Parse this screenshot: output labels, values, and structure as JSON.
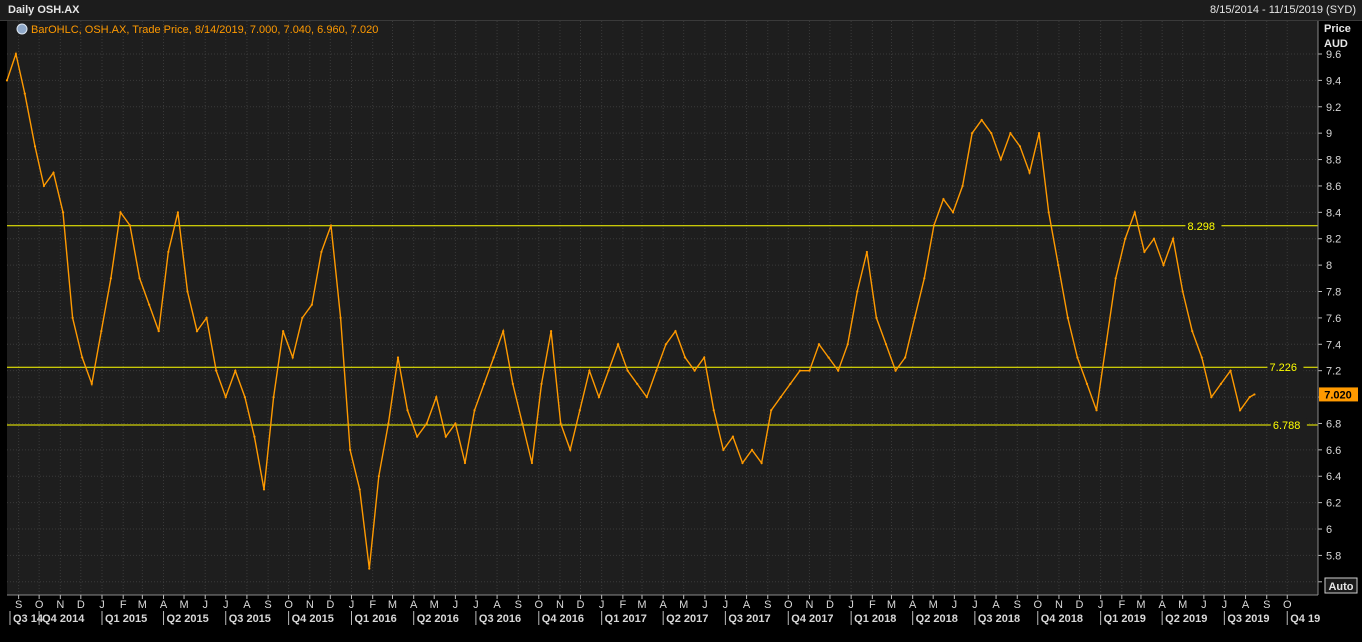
{
  "window": {
    "title": "Daily OSH.AX",
    "date_range": "8/15/2014 - 11/15/2019 (SYD)"
  },
  "legend": {
    "icon": "series-settings-icon",
    "text": "BarOHLC, OSH.AX, Trade Price, 8/14/2019, 7.000, 7.040, 6.960, 7.020"
  },
  "axis": {
    "price_label": "Price",
    "currency_label": "AUD",
    "auto_button": "Auto",
    "last_price_label": "7.020"
  },
  "colors": {
    "background": "#1e1e1e",
    "grid": "#3a3a3a",
    "series": "#ff9a00",
    "level_line": "#ffff00",
    "axis_text": "#d8d8d8"
  },
  "chart_data": {
    "type": "line",
    "series": [
      {
        "name": "OSH.AX",
        "x": [
          "2014-08-15",
          "2014-08-28",
          "2014-09-10",
          "2014-09-25",
          "2014-10-08",
          "2014-10-22",
          "2014-11-05",
          "2014-11-19",
          "2014-12-03",
          "2014-12-17",
          "2014-12-31",
          "2015-01-14",
          "2015-01-28",
          "2015-02-11",
          "2015-02-25",
          "2015-03-11",
          "2015-03-25",
          "2015-04-08",
          "2015-04-22",
          "2015-05-06",
          "2015-05-20",
          "2015-06-03",
          "2015-06-17",
          "2015-07-01",
          "2015-07-15",
          "2015-07-29",
          "2015-08-12",
          "2015-08-26",
          "2015-09-09",
          "2015-09-23",
          "2015-10-07",
          "2015-10-21",
          "2015-11-04",
          "2015-11-18",
          "2015-12-02",
          "2015-12-16",
          "2015-12-30",
          "2016-01-13",
          "2016-01-27",
          "2016-02-10",
          "2016-02-24",
          "2016-03-09",
          "2016-03-23",
          "2016-04-06",
          "2016-04-20",
          "2016-05-04",
          "2016-05-18",
          "2016-06-01",
          "2016-06-15",
          "2016-06-29",
          "2016-07-13",
          "2016-07-27",
          "2016-08-10",
          "2016-08-24",
          "2016-09-07",
          "2016-09-21",
          "2016-10-05",
          "2016-10-19",
          "2016-11-02",
          "2016-11-16",
          "2016-11-30",
          "2016-12-14",
          "2016-12-28",
          "2017-01-11",
          "2017-01-25",
          "2017-02-08",
          "2017-02-22",
          "2017-03-08",
          "2017-03-22",
          "2017-04-05",
          "2017-04-19",
          "2017-05-03",
          "2017-05-17",
          "2017-05-31",
          "2017-06-14",
          "2017-06-28",
          "2017-07-12",
          "2017-07-26",
          "2017-08-09",
          "2017-08-23",
          "2017-09-06",
          "2017-09-20",
          "2017-10-04",
          "2017-10-18",
          "2017-11-01",
          "2017-11-15",
          "2017-11-29",
          "2017-12-13",
          "2017-12-27",
          "2018-01-10",
          "2018-01-24",
          "2018-02-07",
          "2018-02-21",
          "2018-03-07",
          "2018-03-21",
          "2018-04-04",
          "2018-04-18",
          "2018-05-02",
          "2018-05-16",
          "2018-05-30",
          "2018-06-13",
          "2018-06-27",
          "2018-07-11",
          "2018-07-25",
          "2018-08-08",
          "2018-08-22",
          "2018-09-05",
          "2018-09-19",
          "2018-10-03",
          "2018-10-17",
          "2018-10-31",
          "2018-11-14",
          "2018-11-28",
          "2018-12-12",
          "2018-12-26",
          "2019-01-09",
          "2019-01-23",
          "2019-02-06",
          "2019-02-20",
          "2019-03-06",
          "2019-03-20",
          "2019-04-03",
          "2019-04-17",
          "2019-05-01",
          "2019-05-15",
          "2019-05-29",
          "2019-06-12",
          "2019-06-26",
          "2019-07-10",
          "2019-07-24",
          "2019-08-07",
          "2019-08-14"
        ],
        "values": [
          9.4,
          9.6,
          9.3,
          8.9,
          8.6,
          8.7,
          8.4,
          7.6,
          7.3,
          7.1,
          7.5,
          7.9,
          8.4,
          8.3,
          7.9,
          7.7,
          7.5,
          8.1,
          8.4,
          7.8,
          7.5,
          7.6,
          7.2,
          7.0,
          7.2,
          7.0,
          6.7,
          6.3,
          7.0,
          7.5,
          7.3,
          7.6,
          7.7,
          8.1,
          8.3,
          7.6,
          6.6,
          6.3,
          5.7,
          6.4,
          6.8,
          7.3,
          6.9,
          6.7,
          6.8,
          7.0,
          6.7,
          6.8,
          6.5,
          6.9,
          7.1,
          7.3,
          7.5,
          7.1,
          6.8,
          6.5,
          7.1,
          7.5,
          6.8,
          6.6,
          6.9,
          7.2,
          7.0,
          7.2,
          7.4,
          7.2,
          7.1,
          7.0,
          7.2,
          7.4,
          7.5,
          7.3,
          7.2,
          7.3,
          6.9,
          6.6,
          6.7,
          6.5,
          6.6,
          6.5,
          6.9,
          7.0,
          7.1,
          7.2,
          7.2,
          7.4,
          7.3,
          7.2,
          7.4,
          7.8,
          8.1,
          7.6,
          7.4,
          7.2,
          7.3,
          7.6,
          7.9,
          8.3,
          8.5,
          8.4,
          8.6,
          9.0,
          9.1,
          9.0,
          8.8,
          9.0,
          8.9,
          8.7,
          9.0,
          8.4,
          8.0,
          7.6,
          7.3,
          7.1,
          6.9,
          7.4,
          7.9,
          8.2,
          8.4,
          8.1,
          8.2,
          8.0,
          8.2,
          7.8,
          7.5,
          7.3,
          7.0,
          7.1,
          7.2,
          6.9,
          7.0,
          7.02
        ]
      }
    ],
    "y_axis": {
      "label": "Price AUD",
      "ylim": [
        5.5,
        9.85
      ],
      "ticks": [
        5.6,
        5.8,
        6,
        6.2,
        6.4,
        6.6,
        6.8,
        7,
        7.2,
        7.4,
        7.6,
        7.8,
        8,
        8.2,
        8.4,
        8.6,
        8.8,
        9,
        9.2,
        9.4,
        9.6
      ],
      "tick_labels": [
        "5.6",
        "5.8",
        "6",
        "6.2",
        "6.4",
        "6.6",
        "6.8",
        "7",
        "7.2",
        "7.4",
        "7.6",
        "7.8",
        "8",
        "8.2",
        "8.4",
        "8.6",
        "8.8",
        "9",
        "9.2",
        "9.4",
        "9.6"
      ],
      "position": "right"
    },
    "x_axis": {
      "range": [
        "2014-08-15",
        "2019-11-15"
      ],
      "months": [
        {
          "date": "2014-09-01",
          "label": "S"
        },
        {
          "date": "2014-10-01",
          "label": "O"
        },
        {
          "date": "2014-11-01",
          "label": "N"
        },
        {
          "date": "2014-12-01",
          "label": "D"
        },
        {
          "date": "2015-01-01",
          "label": "J"
        },
        {
          "date": "2015-02-01",
          "label": "F"
        },
        {
          "date": "2015-03-01",
          "label": "M"
        },
        {
          "date": "2015-04-01",
          "label": "A"
        },
        {
          "date": "2015-05-01",
          "label": "M"
        },
        {
          "date": "2015-06-01",
          "label": "J"
        },
        {
          "date": "2015-07-01",
          "label": "J"
        },
        {
          "date": "2015-08-01",
          "label": "A"
        },
        {
          "date": "2015-09-01",
          "label": "S"
        },
        {
          "date": "2015-10-01",
          "label": "O"
        },
        {
          "date": "2015-11-01",
          "label": "N"
        },
        {
          "date": "2015-12-01",
          "label": "D"
        },
        {
          "date": "2016-01-01",
          "label": "J"
        },
        {
          "date": "2016-02-01",
          "label": "F"
        },
        {
          "date": "2016-03-01",
          "label": "M"
        },
        {
          "date": "2016-04-01",
          "label": "A"
        },
        {
          "date": "2016-05-01",
          "label": "M"
        },
        {
          "date": "2016-06-01",
          "label": "J"
        },
        {
          "date": "2016-07-01",
          "label": "J"
        },
        {
          "date": "2016-08-01",
          "label": "A"
        },
        {
          "date": "2016-09-01",
          "label": "S"
        },
        {
          "date": "2016-10-01",
          "label": "O"
        },
        {
          "date": "2016-11-01",
          "label": "N"
        },
        {
          "date": "2016-12-01",
          "label": "D"
        },
        {
          "date": "2017-01-01",
          "label": "J"
        },
        {
          "date": "2017-02-01",
          "label": "F"
        },
        {
          "date": "2017-03-01",
          "label": "M"
        },
        {
          "date": "2017-04-01",
          "label": "A"
        },
        {
          "date": "2017-05-01",
          "label": "M"
        },
        {
          "date": "2017-06-01",
          "label": "J"
        },
        {
          "date": "2017-07-01",
          "label": "J"
        },
        {
          "date": "2017-08-01",
          "label": "A"
        },
        {
          "date": "2017-09-01",
          "label": "S"
        },
        {
          "date": "2017-10-01",
          "label": "O"
        },
        {
          "date": "2017-11-01",
          "label": "N"
        },
        {
          "date": "2017-12-01",
          "label": "D"
        },
        {
          "date": "2018-01-01",
          "label": "J"
        },
        {
          "date": "2018-02-01",
          "label": "F"
        },
        {
          "date": "2018-03-01",
          "label": "M"
        },
        {
          "date": "2018-04-01",
          "label": "A"
        },
        {
          "date": "2018-05-01",
          "label": "M"
        },
        {
          "date": "2018-06-01",
          "label": "J"
        },
        {
          "date": "2018-07-01",
          "label": "J"
        },
        {
          "date": "2018-08-01",
          "label": "A"
        },
        {
          "date": "2018-09-01",
          "label": "S"
        },
        {
          "date": "2018-10-01",
          "label": "O"
        },
        {
          "date": "2018-11-01",
          "label": "N"
        },
        {
          "date": "2018-12-01",
          "label": "D"
        },
        {
          "date": "2019-01-01",
          "label": "J"
        },
        {
          "date": "2019-02-01",
          "label": "F"
        },
        {
          "date": "2019-03-01",
          "label": "M"
        },
        {
          "date": "2019-04-01",
          "label": "A"
        },
        {
          "date": "2019-05-01",
          "label": "M"
        },
        {
          "date": "2019-06-01",
          "label": "J"
        },
        {
          "date": "2019-07-01",
          "label": "J"
        },
        {
          "date": "2019-08-01",
          "label": "A"
        },
        {
          "date": "2019-09-01",
          "label": "S"
        },
        {
          "date": "2019-10-01",
          "label": "O"
        }
      ],
      "quarters": [
        {
          "date": "2014-08-15",
          "label": "Q3 14"
        },
        {
          "date": "2014-10-01",
          "label": "Q4 2014"
        },
        {
          "date": "2015-01-01",
          "label": "Q1 2015"
        },
        {
          "date": "2015-04-01",
          "label": "Q2 2015"
        },
        {
          "date": "2015-07-01",
          "label": "Q3 2015"
        },
        {
          "date": "2015-10-01",
          "label": "Q4 2015"
        },
        {
          "date": "2016-01-01",
          "label": "Q1 2016"
        },
        {
          "date": "2016-04-01",
          "label": "Q2 2016"
        },
        {
          "date": "2016-07-01",
          "label": "Q3 2016"
        },
        {
          "date": "2016-10-01",
          "label": "Q4 2016"
        },
        {
          "date": "2017-01-01",
          "label": "Q1 2017"
        },
        {
          "date": "2017-04-01",
          "label": "Q2 2017"
        },
        {
          "date": "2017-07-01",
          "label": "Q3 2017"
        },
        {
          "date": "2017-10-01",
          "label": "Q4 2017"
        },
        {
          "date": "2018-01-01",
          "label": "Q1 2018"
        },
        {
          "date": "2018-04-01",
          "label": "Q2 2018"
        },
        {
          "date": "2018-07-01",
          "label": "Q3 2018"
        },
        {
          "date": "2018-10-01",
          "label": "Q4 2018"
        },
        {
          "date": "2019-01-01",
          "label": "Q1 2019"
        },
        {
          "date": "2019-04-01",
          "label": "Q2 2019"
        },
        {
          "date": "2019-07-01",
          "label": "Q3 2019"
        },
        {
          "date": "2019-10-01",
          "label": "Q4 19"
        }
      ]
    },
    "levels": [
      {
        "value": 8.298,
        "label": "8.298",
        "label_date": "2019-05-08"
      },
      {
        "value": 7.226,
        "label": "7.226",
        "label_date": "2019-09-05"
      },
      {
        "value": 6.788,
        "label": "6.788",
        "label_date": "2019-09-10"
      }
    ],
    "last_value": 7.02,
    "grid": true
  }
}
